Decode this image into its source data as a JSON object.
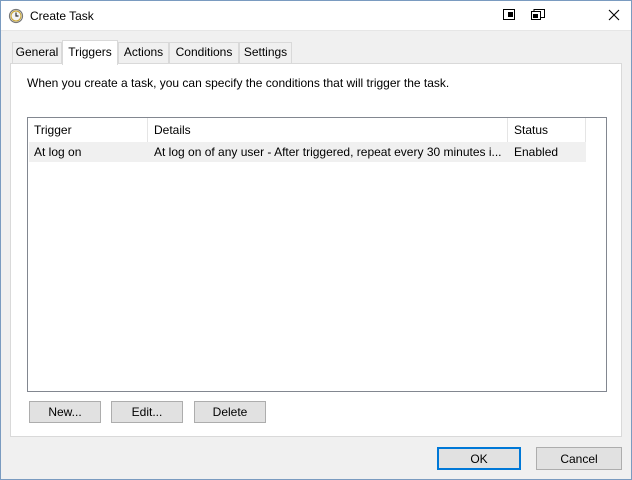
{
  "window": {
    "title": "Create Task",
    "icon": "clock-icon",
    "controls": [
      "restore-icon",
      "snap-icon",
      "close-icon"
    ]
  },
  "tabs": [
    {
      "label": "General",
      "active": false
    },
    {
      "label": "Triggers",
      "active": true
    },
    {
      "label": "Actions",
      "active": false
    },
    {
      "label": "Conditions",
      "active": false
    },
    {
      "label": "Settings",
      "active": false
    }
  ],
  "triggers_panel": {
    "description": "When you create a task, you can specify the conditions that will trigger the task.",
    "columns": [
      "Trigger",
      "Details",
      "Status"
    ],
    "rows": [
      {
        "trigger": "At log on",
        "details": "At log on of any user - After triggered, repeat every 30 minutes i...",
        "status": "Enabled"
      }
    ],
    "buttons": {
      "new": "New...",
      "edit": "Edit...",
      "delete": "Delete"
    }
  },
  "footer": {
    "ok": "OK",
    "cancel": "Cancel"
  },
  "colors": {
    "accent": "#0078d7",
    "selected_row": "#f0f0f0",
    "panel_bg": "#ffffff",
    "window_bg": "#f0f0f0"
  }
}
